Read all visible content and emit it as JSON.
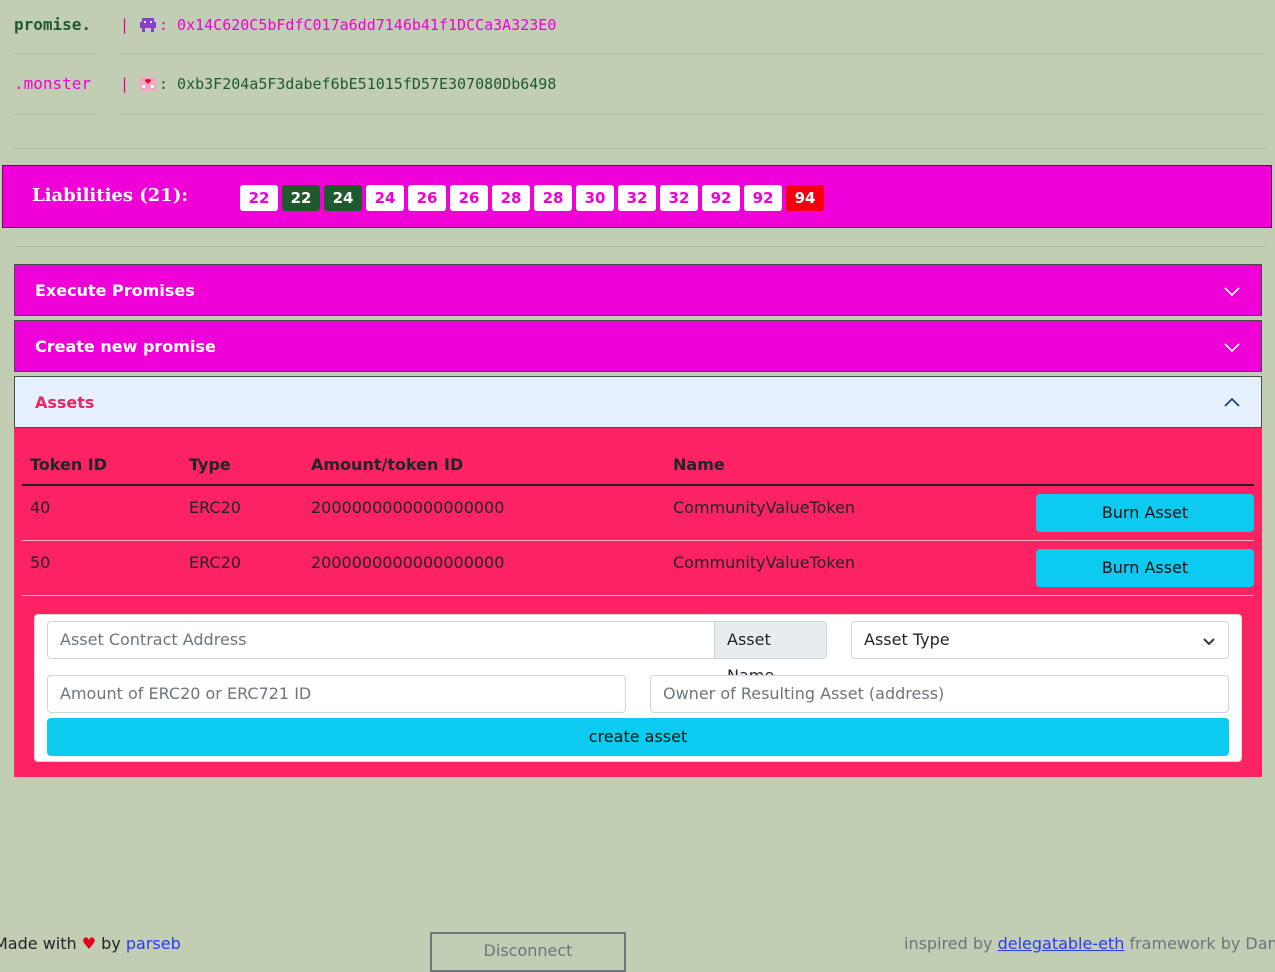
{
  "header": {
    "rows": [
      {
        "label": "promise.",
        "separator": "|",
        "emoji_icon": "alien-monster-icon",
        "addr": ": 0x14C620C5bFdfC017a6dd7146b41f1DCCa3A323E0"
      },
      {
        "label": ".monster",
        "separator": "|",
        "emoji_icon": "love-hotel-icon",
        "addr": ": 0xb3F204a5F3dabef6bE51015fD57E307080Db6498"
      }
    ]
  },
  "liabilities": {
    "title": "Liabilities (21):",
    "chips": [
      {
        "value": "22",
        "style": "white"
      },
      {
        "value": "22",
        "style": "dark"
      },
      {
        "value": "24",
        "style": "dark"
      },
      {
        "value": "24",
        "style": "white"
      },
      {
        "value": "26",
        "style": "white"
      },
      {
        "value": "26",
        "style": "white"
      },
      {
        "value": "28",
        "style": "white"
      },
      {
        "value": "28",
        "style": "white"
      },
      {
        "value": "30",
        "style": "white"
      },
      {
        "value": "32",
        "style": "white"
      },
      {
        "value": "32",
        "style": "white"
      },
      {
        "value": "92",
        "style": "white"
      },
      {
        "value": "92",
        "style": "white"
      },
      {
        "value": "94",
        "style": "red"
      }
    ]
  },
  "accordions": [
    {
      "label": "Execute Promises",
      "expanded": false
    },
    {
      "label": "Create new promise",
      "expanded": false
    },
    {
      "label": "Assets",
      "expanded": true
    }
  ],
  "assets": {
    "columns": [
      "Token ID",
      "Type",
      "Amount/token ID",
      "Name"
    ],
    "rows": [
      {
        "token_id": "40",
        "type": "ERC20",
        "amount": "2000000000000000000",
        "name": "CommunityValueToken",
        "action": "Burn Asset"
      },
      {
        "token_id": "50",
        "type": "ERC20",
        "amount": "2000000000000000000",
        "name": "CommunityValueToken",
        "action": "Burn Asset"
      }
    ],
    "form": {
      "contract_placeholder": "Asset Contract Address",
      "name_addon": "Asset Name",
      "type_select": "Asset Type",
      "amount_placeholder": "Amount of ERC20 or ERC721 ID",
      "owner_placeholder": "Owner of Resulting Asset (address)",
      "create_label": "create asset"
    }
  },
  "footer": {
    "made_with": "Made with",
    "heart": "♥",
    "by": "by",
    "author": "parseb",
    "disconnect": "Disconnect",
    "inspired_by": "inspired by",
    "framework_link": "delegatable-eth",
    "framework_text": "framework by Dan Finlay"
  },
  "colors": {
    "background": "#c1ceb3",
    "magenta": "#ef00d7",
    "assets_panel": "#fd2362",
    "cyan_button": "#0dcaf0",
    "dark_green": "#1e5a2d",
    "red_chip": "#f4000c"
  }
}
